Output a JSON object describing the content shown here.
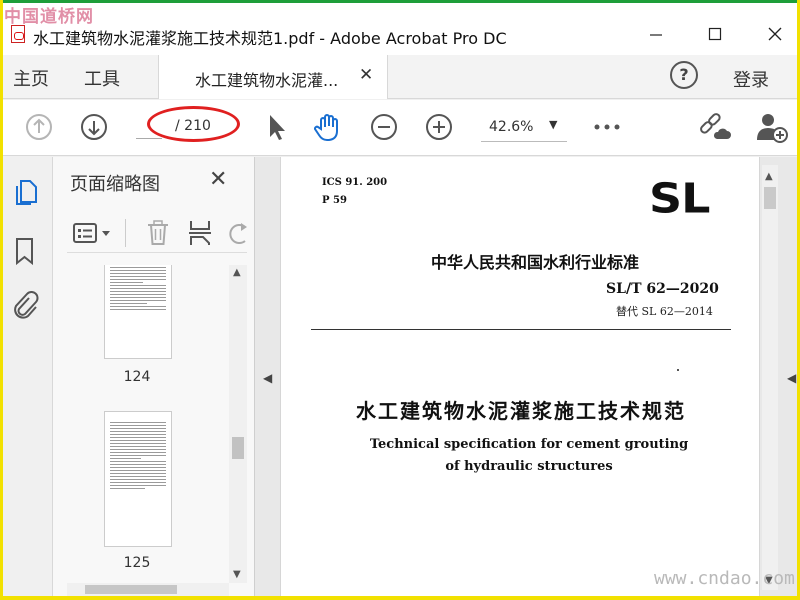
{
  "watermark": {
    "top": "中国道桥网",
    "bottom": "www.cndao.com"
  },
  "window": {
    "title": "水工建筑物水泥灌浆施工技术规范1.pdf - Adobe Acrobat Pro DC",
    "controls": [
      "minimize",
      "maximize",
      "close"
    ]
  },
  "menu": {
    "home": "主页",
    "tools": "工具",
    "doc_tab_label": "水工建筑物水泥灌...",
    "help": "?",
    "login": "登录"
  },
  "toolbar": {
    "page_current": "",
    "page_total": "/ 210",
    "zoom": "42.6%",
    "icons": [
      "prev-page-icon",
      "next-page-icon",
      "select-arrow-icon",
      "hand-tool-icon",
      "zoom-out-icon",
      "zoom-in-icon",
      "more-icon",
      "share-link-icon",
      "add-user-icon"
    ]
  },
  "left_strip": {
    "icons": [
      "pages-icon",
      "bookmark-icon",
      "attachment-icon"
    ]
  },
  "thumbnails": {
    "title": "页面缩略图",
    "pages": [
      {
        "label": "124"
      },
      {
        "label": "125"
      }
    ]
  },
  "document": {
    "ics": "ICS 91. 200",
    "p_code": "P 59",
    "logo": "SL",
    "national_standard": "中华人民共和国水利行业标准",
    "standard_code": "SL/T 62—2020",
    "replaces": "替代 SL 62—2014",
    "title_cn": "水工建筑物水泥灌浆施工技术规范",
    "title_en_line1": "Technical specification for cement grouting",
    "title_en_line2": "of hydraulic structures"
  },
  "colors": {
    "annotation_ellipse": "#e02020",
    "frame_green": "#1e9e3a",
    "frame_yellow": "#f2e100"
  }
}
